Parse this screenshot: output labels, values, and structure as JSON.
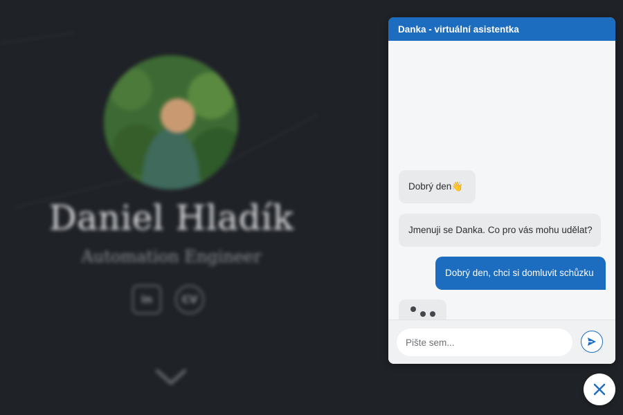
{
  "background": {
    "profile_name": "Daniel Hladík",
    "profile_role": "Automation Engineer",
    "social_links": [
      {
        "label": "in",
        "icon": "linkedin-icon"
      },
      {
        "label": "CV",
        "icon": "cv-icon"
      }
    ],
    "scroll_icon": "chevron-down-icon"
  },
  "chat": {
    "title": "Danka - virtuální asistentka",
    "messages": [
      {
        "sender": "bot",
        "text": "Dobrý den👋"
      },
      {
        "sender": "bot",
        "text": "Jmenuji se Danka. Co pro vás mohu udělat?"
      },
      {
        "sender": "user",
        "text": "Dobrý den, chci si domluvit schůzku"
      }
    ],
    "typing_indicator": true,
    "input": {
      "placeholder": "Pište sem...",
      "value": ""
    },
    "send_icon": "send-icon",
    "close_icon": "close-icon"
  },
  "colors": {
    "accent": "#1c6cbf",
    "page_background": "#1f2227",
    "bot_bubble": "#e9eaec",
    "user_bubble": "#1c6cbf"
  }
}
